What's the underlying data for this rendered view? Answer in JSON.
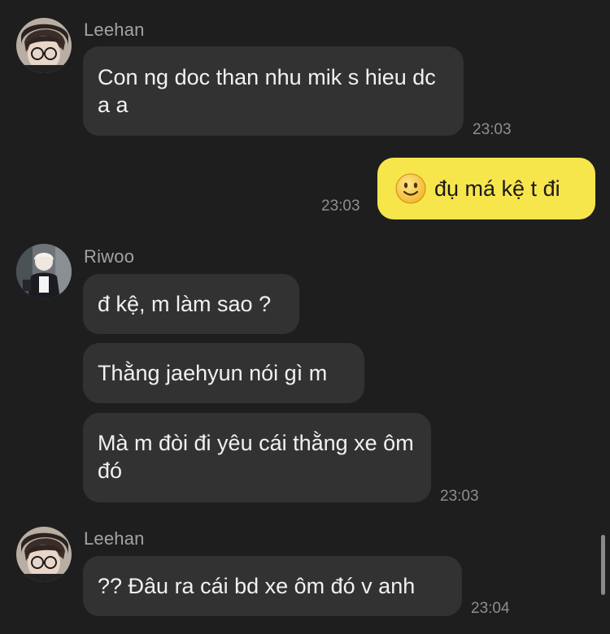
{
  "messages": [
    {
      "sender": "Leehan",
      "text": "Con ng doc than nhu mik s hieu dc a a",
      "time": "23:03"
    },
    {
      "mine": true,
      "emoji": "slightly-smiling-face",
      "text": "đụ má kệ t đi",
      "time": "23:03"
    },
    {
      "sender": "Riwoo",
      "text": "đ kệ, m làm sao ?"
    },
    {
      "text": "Thằng jaehyun nói gì m"
    },
    {
      "text": "Mà m đòi đi yêu cái thằng xe ôm đó",
      "time": "23:03"
    },
    {
      "sender": "Leehan",
      "text": "?? Đâu ra cái bd xe ôm đó v anh",
      "time": "23:04"
    }
  ],
  "colors": {
    "background": "#1e1e1f",
    "incoming_bubble": "#323233",
    "outgoing_bubble": "#f7e54c",
    "sender_text": "#a3a3a6",
    "timestamp": "#8e8e92"
  },
  "icons": {
    "avatar_leehan": "avatar-leehan",
    "avatar_riwoo": "avatar-riwoo",
    "emoji": "slightly-smiling-face-icon"
  }
}
